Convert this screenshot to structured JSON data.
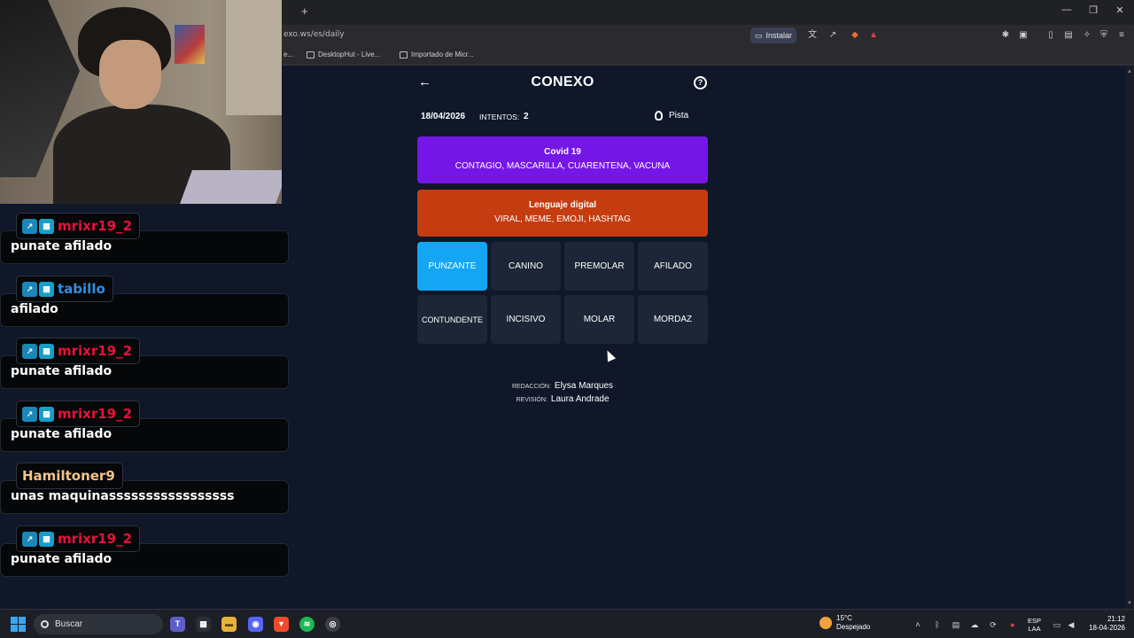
{
  "browser": {
    "url": "exo.ws/es/daily",
    "install_label": "Instalar",
    "bookmarks": [
      {
        "label": "e..."
      },
      {
        "label": "DesktopHut - Live..."
      },
      {
        "label": "Importado de Micr..."
      }
    ]
  },
  "game": {
    "title": "CONEXO",
    "date": "18/04/2026",
    "tries_label": "INTENTOS:",
    "tries_value": "2",
    "hint_label": "Pista",
    "solved_groups": [
      {
        "name": "Covid 19",
        "words": "CONTAGIO, MASCARILLA, CUARENTENA, VACUNA",
        "color": "#7417e6"
      },
      {
        "name": "Lenguaje digital",
        "words": "VIRAL, MEME, EMOJI, HASHTAG",
        "color": "#c43c10"
      }
    ],
    "tiles": [
      {
        "label": "PUNZANTE",
        "selected": true
      },
      {
        "label": "CANINO",
        "selected": false
      },
      {
        "label": "PREMOLAR",
        "selected": false
      },
      {
        "label": "AFILADO",
        "selected": false
      },
      {
        "label": "CONTUNDENTE",
        "selected": false
      },
      {
        "label": "INCISIVO",
        "selected": false
      },
      {
        "label": "MOLAR",
        "selected": false
      },
      {
        "label": "MORDAZ",
        "selected": false
      }
    ],
    "credits": {
      "writing_label": "REDACCIÓN:",
      "writing_name": "Elysa Marques",
      "review_label": "REVISIÓN:",
      "review_name": "Laura Andrade"
    },
    "selected_color": "#14a5f3"
  },
  "chat": {
    "messages": [
      {
        "user": "mrixr19_2",
        "user_color": "#e8113a",
        "text": "punate afilado",
        "badges": true
      },
      {
        "user": "tabillo",
        "user_color": "#2e8fe6",
        "text": "afilado",
        "badges": true
      },
      {
        "user": "mrixr19_2",
        "user_color": "#e8113a",
        "text": "punate afilado",
        "badges": true
      },
      {
        "user": "mrixr19_2",
        "user_color": "#e8113a",
        "text": "punate afilado",
        "badges": true
      },
      {
        "user": "Hamiltoner9",
        "user_color": "#f2c38a",
        "text": "unas maquinasssssssssssssssss",
        "badges": false
      },
      {
        "user": "mrixr19_2",
        "user_color": "#e8113a",
        "text": "punate afilado",
        "badges": true
      }
    ]
  },
  "taskbar": {
    "search_placeholder": "Buscar",
    "weather_temp": "15°C",
    "weather_desc": "Despejado",
    "lang_top": "ESP",
    "lang_bottom": "LAA",
    "time": "21:12",
    "date": "18-04-2026"
  }
}
